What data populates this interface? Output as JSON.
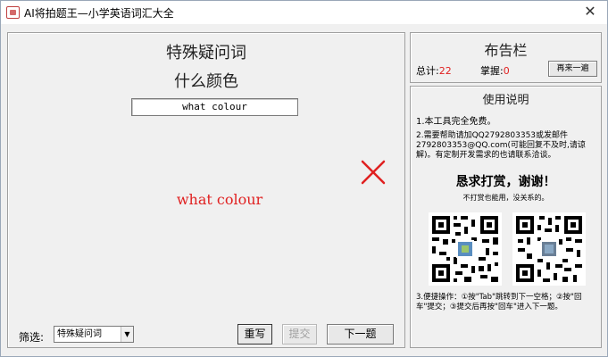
{
  "window": {
    "title": "AI将拍题王—小学英语词汇大全",
    "close_symbol": "✕"
  },
  "quiz": {
    "category": "特殊疑问词",
    "meaning": "什么颜色",
    "input_value": "what  colour",
    "correct_answer": "what colour",
    "result": "wrong",
    "filter_label": "筛选:",
    "filter_value": "特殊疑问词",
    "rewrite_label": "重写",
    "submit_label": "提交",
    "next_label": "下一题"
  },
  "notice": {
    "title": "布告栏",
    "total_label": "总计:",
    "total_value": "22",
    "mastered_label": "掌握:",
    "mastered_value": "0",
    "again_label": "再来一遍"
  },
  "guide": {
    "title": "使用说明",
    "item1": "1.本工具完全免费。",
    "item2": "2.需要帮助请加QQ2792803353或发邮件2792803353@QQ.com(可能回复不及时,请谅解)。有定制开发需求的也请联系洽谈。",
    "reward_title": "恳求打赏，谢谢！",
    "reward_sub": "不打赏也能用，没关系的。",
    "item3": "3.便捷操作：①按\"Tab\"跳转到下一空格；②按\"回车\"提交；③提交后再按\"回车\"进入下一题。"
  },
  "colors": {
    "error_red": "#e02020",
    "window_bg": "#f0f0f0"
  }
}
